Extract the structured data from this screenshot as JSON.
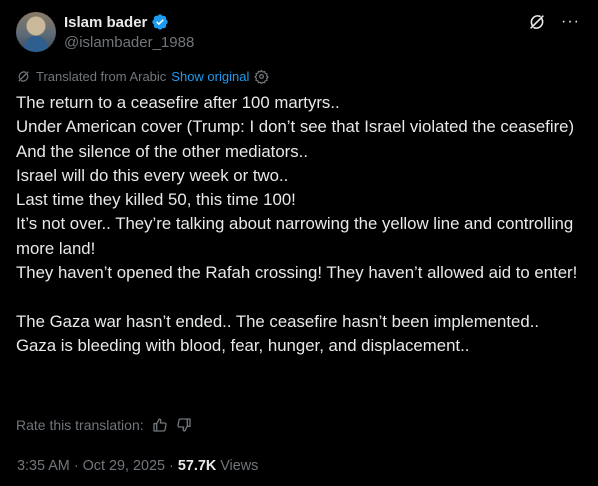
{
  "author": {
    "display_name": "Islam bader",
    "handle": "@islambader_1988"
  },
  "translation": {
    "notice": "Translated from Arabic",
    "show_original": "Show original",
    "rate_label": "Rate this translation:"
  },
  "tweet": {
    "text": "The return to a ceasefire after 100 martyrs..\nUnder American cover (Trump: I don’t see that Israel violated the ceasefire)\nAnd the silence of the other mediators..\nIsrael will do this every week or two..\nLast time they killed 50, this time 100!\nIt’s not over.. They’re talking about narrowing the yellow line and controlling more land!\nThey haven’t opened the Rafah crossing! They haven’t allowed aid to enter!\n\nThe Gaza war hasn’t ended.. The ceasefire hasn’t been implemented..\nGaza is bleeding with blood, fear, hunger, and displacement.."
  },
  "meta": {
    "time": "3:35 AM",
    "sep1": "·",
    "date": "Oct 29, 2025",
    "sep2": "·",
    "views_count": "57.7K",
    "views_label": "Views"
  },
  "colors": {
    "background": "#000000",
    "text": "#e7e9ea",
    "muted": "#71767b",
    "accent": "#1d9bf0"
  },
  "icons": {
    "verified": "verified-badge-icon",
    "grok": "grok-icon",
    "more": "more-icon",
    "translate": "translate-icon",
    "settings": "gear-icon",
    "thumbs_up": "thumbs-up-icon",
    "thumbs_down": "thumbs-down-icon"
  }
}
